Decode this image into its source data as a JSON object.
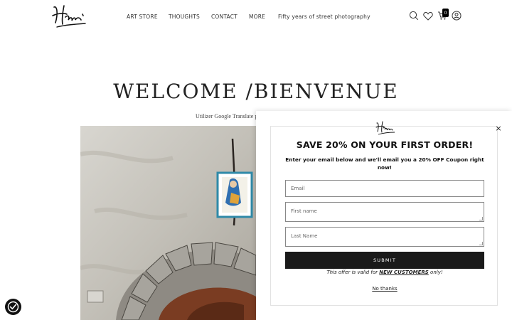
{
  "header": {
    "logo_text": "Henri",
    "nav": [
      {
        "label": "ART STORE"
      },
      {
        "label": "THOUGHTS"
      },
      {
        "label": "CONTACT"
      },
      {
        "label": "MORE"
      },
      {
        "label": "Fifty years of street photography"
      }
    ],
    "icons": [
      "search-icon",
      "heart-icon",
      "cart-icon",
      "user-icon"
    ],
    "cart_count": "0"
  },
  "hero": {
    "title": "WELCOME /BIENVENUE",
    "translate_note": "Utilizer Google Translate p"
  },
  "popup": {
    "title": "SAVE 20% ON YOUR FIRST ORDER!",
    "subtitle": "Enter your email below and we'll email you a 20% OFF Coupon right now!",
    "email_placeholder": "Email",
    "first_name_placeholder": "First name",
    "last_name_placeholder": "Last Name",
    "submit_label": "SUBMIT",
    "offer_prefix": "This offer is valid for ",
    "offer_emphasis": "NEW CUSTOMERS",
    "offer_suffix": " only!",
    "no_thanks_label": "No thanks",
    "close_label": "×"
  },
  "colors": {
    "button_bg": "#1a1a1a",
    "text": "#222222",
    "border": "#888888"
  }
}
